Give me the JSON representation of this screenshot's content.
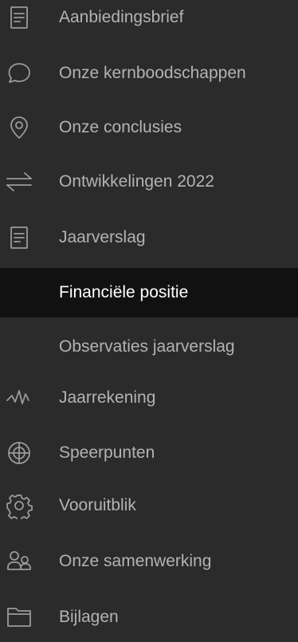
{
  "sidebar": {
    "items": [
      {
        "label": "Aanbiedingsbrief",
        "icon": "document-icon"
      },
      {
        "label": "Onze kernboodschappen",
        "icon": "speech-bubble-icon"
      },
      {
        "label": "Onze conclusies",
        "icon": "location-pin-icon"
      },
      {
        "label": "Ontwikkelingen 2022",
        "icon": "arrows-exchange-icon"
      },
      {
        "label": "Jaarverslag",
        "icon": "document-icon"
      },
      {
        "label": "Financiële positie",
        "icon": null,
        "active": true
      },
      {
        "label": "Observaties jaarverslag",
        "icon": null
      },
      {
        "label": "Jaarrekening",
        "icon": "pulse-line-icon"
      },
      {
        "label": "Speerpunten",
        "icon": "crosshair-icon"
      },
      {
        "label": "Vooruitblik",
        "icon": "gear-icon"
      },
      {
        "label": "Onze samenwerking",
        "icon": "people-icon"
      },
      {
        "label": "Bijlagen",
        "icon": "folder-icon"
      }
    ]
  },
  "colors": {
    "background": "#2b2b2b",
    "active_background": "#111111",
    "text": "#b3b3b3",
    "active_text": "#ffffff",
    "icon": "#9a9a9a"
  }
}
